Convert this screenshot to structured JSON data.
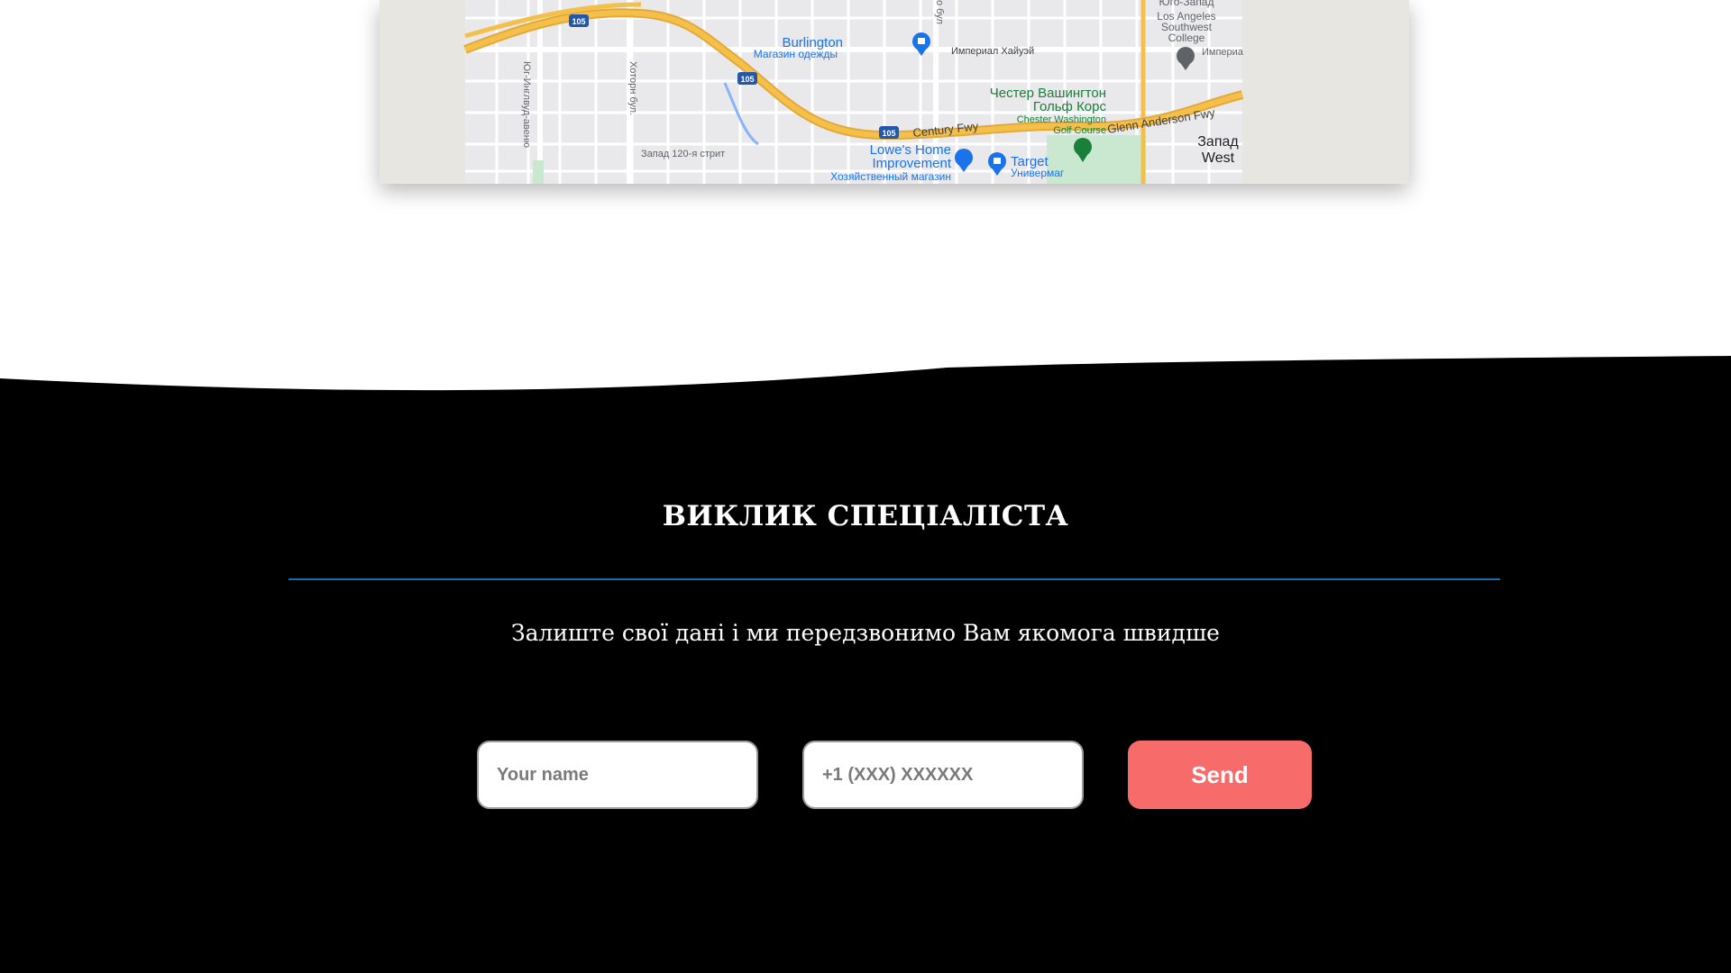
{
  "map": {
    "labels": {
      "burlington": "Burlington",
      "burlington_sub": "Магазин одежды",
      "imperial_hwy": "Империал Хайуэй",
      "chester_ru_1": "Честер Вашингтон",
      "chester_ru_2": "Гольф Корс",
      "chester_en_1": "Chester Washington",
      "chester_en_2": "Golf Course",
      "glenn_anderson": "Glenn Anderson Fwy",
      "century_fwy": "Century Fwy",
      "lowes_1": "Lowe's Home",
      "lowes_2": "Improvement",
      "lowes_sub": "Хозяйственный магазин",
      "target": "Target",
      "target_sub": "Универмаг",
      "west_120": "Запад 120-я стрит",
      "la_southwest_1": "Юго-Запад",
      "la_southwest_2": "Los Angeles",
      "la_southwest_3": "Southwest",
      "la_southwest_4": "College",
      "imperial_right": "Империа",
      "west_ru": "Запад",
      "west_en": "West",
      "inglewood_ave": "Юг-Инглвуд-авеню",
      "hawthorne_blvd": "Хоторн бул.",
      "blvd_top": "о бул",
      "shield_105": "105"
    },
    "colors": {
      "freeway": "#f5c04a",
      "freeway_edge": "#e3a93a",
      "street": "#ffffff",
      "base": "#e8e6e1",
      "blue_label": "#1a73e8",
      "green_label": "#188038"
    }
  },
  "contact": {
    "title": "ВИКЛИК СПЕЦІАЛІСТА",
    "subtitle": "Залиште свої дані і ми передзвонимо Вам якомога швидше",
    "name_placeholder": "Your name",
    "phone_placeholder": "+1 (XXX) XXXXXX",
    "send_label": "Send",
    "accent": "#f76b6b",
    "divider_color": "#1f6ea6"
  }
}
